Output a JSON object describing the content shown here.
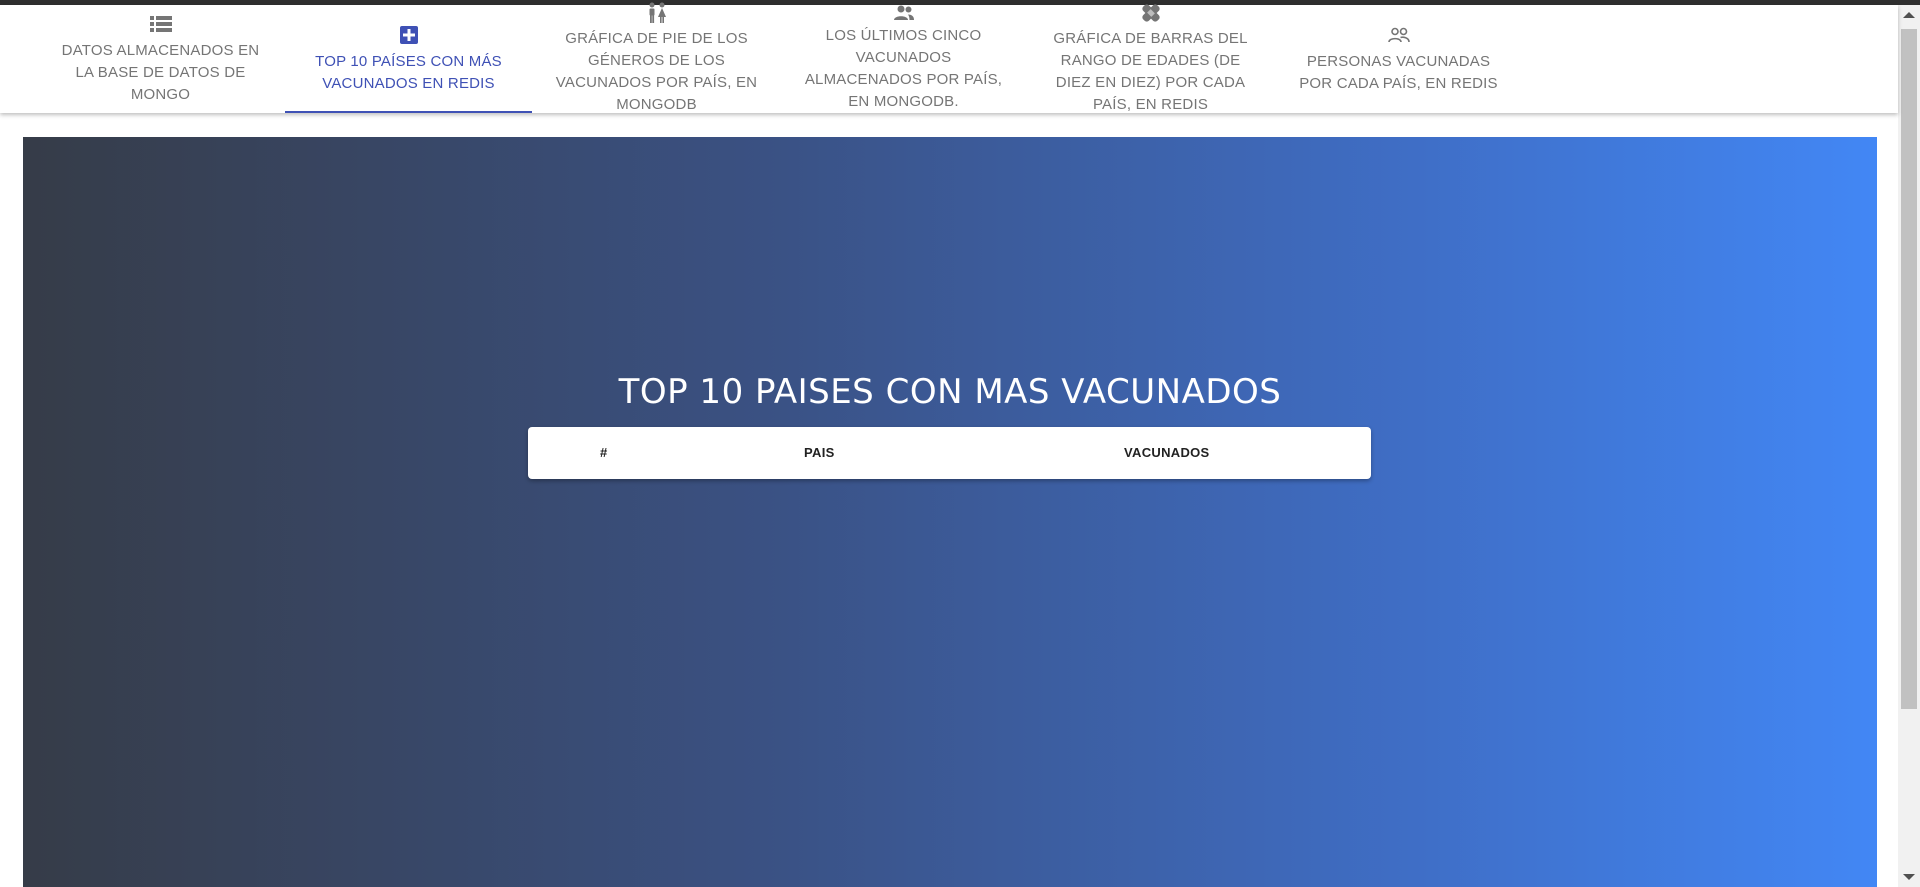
{
  "nav": {
    "tabs": [
      {
        "label": "DATOS ALMACENADOS EN LA BASE DE DATOS DE MONGO",
        "icon": "database-list-icon"
      },
      {
        "label": "TOP 10 PAÍSES CON MÁS VACUNADOS EN REDIS",
        "icon": "medical-plus-icon",
        "active": true
      },
      {
        "label": "GRÁFICA DE PIE DE LOS GÉNEROS DE LOS VACUNADOS POR PAÍS, EN MONGODB",
        "icon": "man-woman-icon"
      },
      {
        "label": "LOS ÚLTIMOS CINCO VACUNADOS ALMACENADOS POR PAÍS, EN MONGODB.",
        "icon": "people-icon"
      },
      {
        "label": "GRÁFICA DE BARRAS DEL RANGO DE EDADES (DE DIEZ EN DIEZ) POR CADA PAÍS, EN REDIS",
        "icon": "bandage-icon"
      },
      {
        "label": "PERSONAS VACUNADAS POR CADA PAÍS, EN REDIS",
        "icon": "people-outline-icon"
      }
    ]
  },
  "main": {
    "title": "TOP 10 PAISES CON MAS VACUNADOS",
    "table": {
      "headers": [
        "#",
        "PAIS",
        "VACUNADOS"
      ],
      "rows": []
    }
  },
  "colors": {
    "accent": "#3f51b5",
    "gradient_start": "#363c48",
    "gradient_end": "#4287f5",
    "tab_text": "#757575"
  }
}
